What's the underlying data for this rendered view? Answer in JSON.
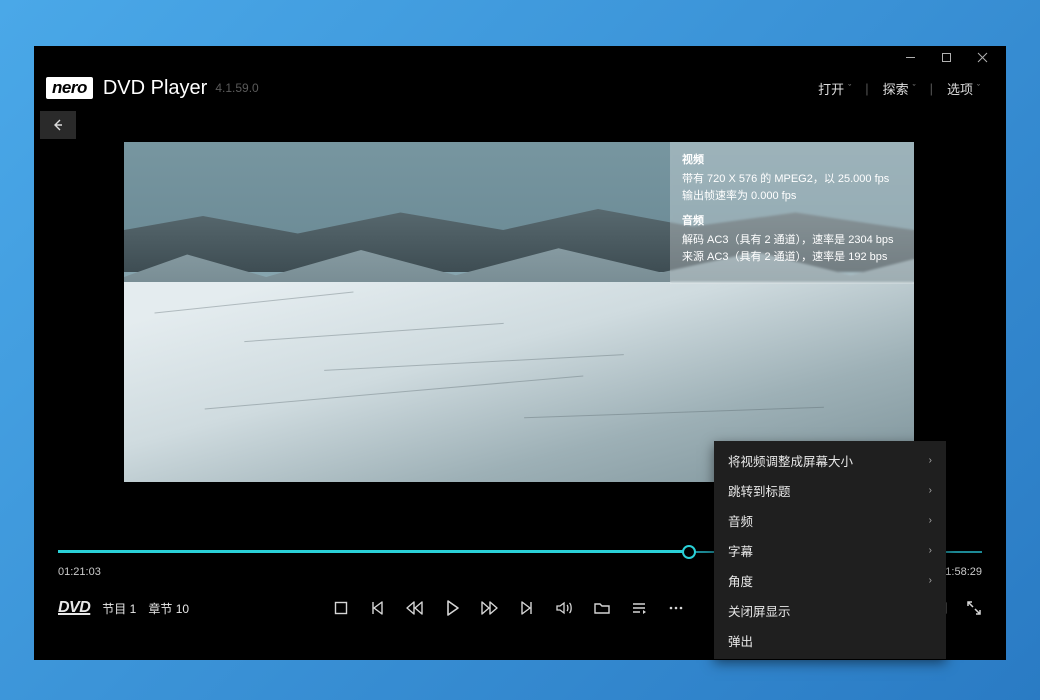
{
  "app": {
    "brand": "nero",
    "title": "DVD Player",
    "version": "4.1.59.0"
  },
  "header_menu": {
    "open": "打开",
    "explore": "探索",
    "options": "选项"
  },
  "info_panel": {
    "video_hdr": "视频",
    "video_line1": "带有 720 X 576 的 MPEG2，以 25.000 fps",
    "video_line2": "输出帧速率为 0.000 fps",
    "audio_hdr": "音频",
    "audio_line1": "解码 AC3（具有 2 通道），速率是 2304 bps",
    "audio_line2": "来源 AC3（具有 2 通道），速率是 192 bps"
  },
  "context_menu": {
    "fit_screen": "将视频调整成屏幕大小",
    "jump_title": "跳转到标题",
    "audio": "音频",
    "subtitle": "字幕",
    "angle": "角度",
    "close_osd": "关闭屏显示",
    "eject": "弹出"
  },
  "playback": {
    "current": "01:21:03",
    "total": "01:58:29",
    "progress_pct": 68.3
  },
  "status": {
    "disc": "DVD",
    "program_label": "节目",
    "program_num": "1",
    "chapter_label": "章节",
    "chapter_num": "10"
  }
}
